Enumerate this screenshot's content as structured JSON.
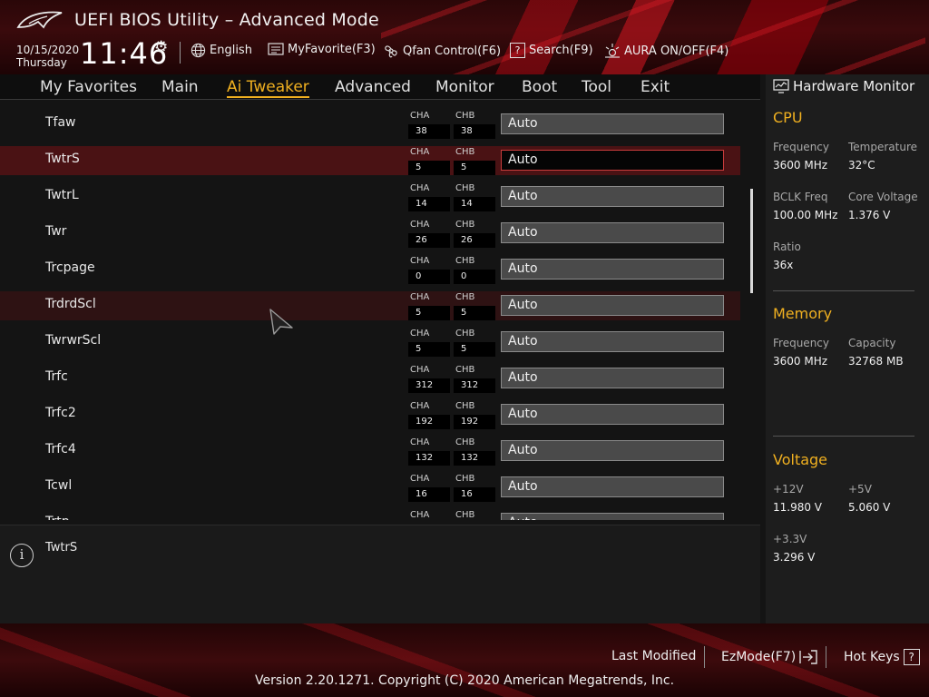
{
  "header": {
    "title": "UEFI BIOS Utility – Advanced Mode",
    "date": "10/15/2020",
    "day": "Thursday",
    "time": "11:46",
    "tools": [
      {
        "label": "English",
        "icon": "globe-icon"
      },
      {
        "label": "MyFavorite(F3)",
        "icon": "favorite-icon"
      },
      {
        "label": "Qfan Control(F6)",
        "icon": "fan-icon"
      },
      {
        "label": "Search(F9)",
        "icon": "search-icon"
      },
      {
        "label": "AURA ON/OFF(F4)",
        "icon": "aura-icon"
      }
    ]
  },
  "menu": {
    "items": [
      "My Favorites",
      "Main",
      "Ai Tweaker",
      "Advanced",
      "Monitor",
      "Boot",
      "Tool",
      "Exit"
    ],
    "active": "Ai Tweaker"
  },
  "channel_labels": {
    "a": "CHA",
    "b": "CHB"
  },
  "settings": [
    {
      "name": "Tfaw",
      "cha": "38",
      "chb": "38",
      "value": "Auto"
    },
    {
      "name": "TwtrS",
      "cha": "5",
      "chb": "5",
      "value": "Auto"
    },
    {
      "name": "TwtrL",
      "cha": "14",
      "chb": "14",
      "value": "Auto"
    },
    {
      "name": "Twr",
      "cha": "26",
      "chb": "26",
      "value": "Auto"
    },
    {
      "name": "Trcpage",
      "cha": "0",
      "chb": "0",
      "value": "Auto"
    },
    {
      "name": "TrdrdScl",
      "cha": "5",
      "chb": "5",
      "value": "Auto"
    },
    {
      "name": "TwrwrScl",
      "cha": "5",
      "chb": "5",
      "value": "Auto"
    },
    {
      "name": "Trfc",
      "cha": "312",
      "chb": "312",
      "value": "Auto"
    },
    {
      "name": "Trfc2",
      "cha": "192",
      "chb": "192",
      "value": "Auto"
    },
    {
      "name": "Trfc4",
      "cha": "132",
      "chb": "132",
      "value": "Auto"
    },
    {
      "name": "Tcwl",
      "cha": "16",
      "chb": "16",
      "value": "Auto"
    },
    {
      "name": "Trtp",
      "cha": "",
      "chb": "",
      "value": "Auto"
    }
  ],
  "help": {
    "text": "TwtrS"
  },
  "hardware_monitor": {
    "title": "Hardware Monitor",
    "cpu": {
      "heading": "CPU",
      "frequency_label": "Frequency",
      "frequency": "3600 MHz",
      "temperature_label": "Temperature",
      "temperature": "32°C",
      "bclk_label": "BCLK Freq",
      "bclk": "100.00 MHz",
      "core_voltage_label": "Core Voltage",
      "core_voltage": "1.376 V",
      "ratio_label": "Ratio",
      "ratio": "36x"
    },
    "memory": {
      "heading": "Memory",
      "frequency_label": "Frequency",
      "frequency": "3600 MHz",
      "capacity_label": "Capacity",
      "capacity": "32768 MB"
    },
    "voltage": {
      "heading": "Voltage",
      "v12_label": "+12V",
      "v12": "11.980 V",
      "v5_label": "+5V",
      "v5": "5.060 V",
      "v33_label": "+3.3V",
      "v33": "3.296 V"
    }
  },
  "footer": {
    "last_modified": "Last Modified",
    "ezmode": "EzMode(F7)",
    "hotkeys": "Hot Keys",
    "hotkeys_icon_glyph": "?",
    "copyright": "Version 2.20.1271. Copyright (C) 2020 American Megatrends, Inc."
  },
  "colors": {
    "accent": "#f0b020",
    "highlight_row": "#4a1214",
    "background": "#141414"
  }
}
